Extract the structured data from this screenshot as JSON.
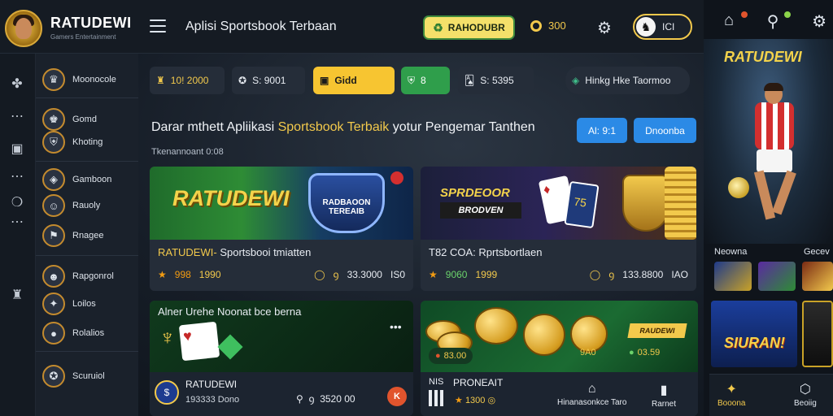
{
  "app": {
    "brand": "RATUDEWI",
    "brand_sub": "Gamers Entertainment",
    "page_title": "Aplisi Sportsbook Terbaan"
  },
  "header": {
    "promo_label": "RAHODUBR",
    "balance": "300",
    "user_label": "ICI"
  },
  "stats": [
    {
      "label": "10! 2000"
    },
    {
      "label": "S: 9001"
    },
    {
      "label": "Gidd"
    },
    {
      "label": "8"
    },
    {
      "label": "S: 5395"
    },
    {
      "label": "Hinkg Hke Taormoo"
    }
  ],
  "sidebar": {
    "items": [
      {
        "label": "Moonocole"
      },
      {
        "label": "Gomd"
      },
      {
        "label": "Khoting"
      },
      {
        "label": "Gamboon"
      },
      {
        "label": "Rauoly"
      },
      {
        "label": "Rnagee"
      },
      {
        "label": "Rapgonrol"
      },
      {
        "label": "Loilos"
      },
      {
        "label": "Rolalios"
      },
      {
        "label": "Scuruiol"
      }
    ]
  },
  "main": {
    "headline_pre": "Darar mthett Apliikasi ",
    "headline_hl": "Sportsbook Terbaik",
    "headline_post": " yotur Pengemar Tanthen",
    "date": "Tkenannoant 0:08",
    "btn1": "Al: 9:1",
    "btn2": "Dnoonba"
  },
  "cards": {
    "c1": {
      "art_title": "RATUDEWI",
      "shield_text": "RADBAOON TEREAIB",
      "name_gold": "RATUDEWI- ",
      "name_rest": "Sportsbooi tmiatten",
      "v1": "998",
      "v2": "1990",
      "v3": "33.3000",
      "v4": "IS0"
    },
    "c2": {
      "art_title": "SPRDEOOR",
      "art_sub": "BRODVEN",
      "card_num": "75",
      "name": "T82 COA: Rprtsbortlaen",
      "v1": "9060",
      "v2": "1999",
      "v3": "133.8800",
      "v4": "IAO"
    },
    "c3": {
      "title": "Alner Urehe Noonat bce berna",
      "badge": "$",
      "name": "RATUDEWI",
      "sub": "193333 Dono",
      "amt": "3520 00",
      "close": "K"
    },
    "c4": {
      "ribbon": "RAUDEWI",
      "chip1": "83.00",
      "chip2": "9A0",
      "chip3": "03.59",
      "tag": "NIS",
      "name": "PRONEAIT",
      "pts": "1300",
      "act1": "Hinanasonkce Taro",
      "act2": "Rarnet"
    }
  },
  "right_panel": {
    "brand": "RATUDEWI",
    "row_label_1": "Neowna",
    "row_label_2": "Gecev",
    "thumb_text": "SIURAN!",
    "bottom_btn_1": "Booona",
    "bottom_btn_2": "Beoiig"
  },
  "colors": {
    "accent_gold": "#f2c94c",
    "accent_blue": "#2b8ae6",
    "accent_green": "#2f9e4b",
    "bg_dark": "#151b23"
  }
}
